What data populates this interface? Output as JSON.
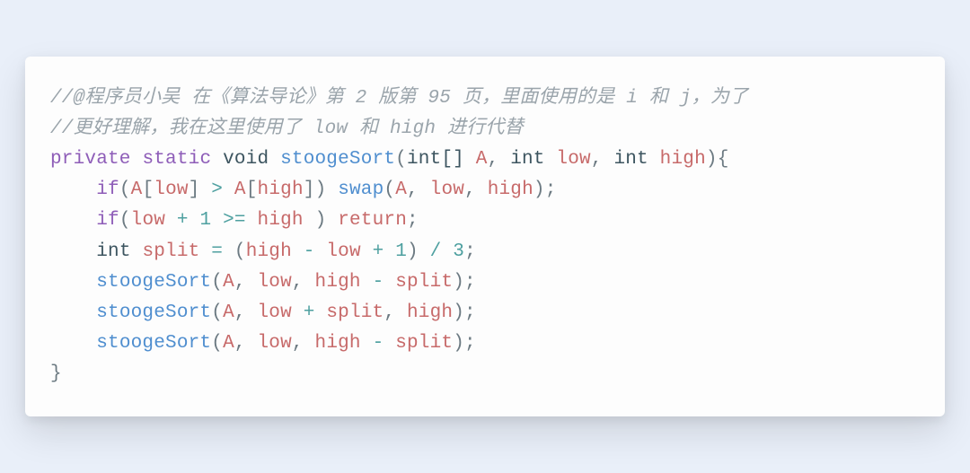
{
  "code": {
    "comment1": "//@程序员小吴 在《算法导论》第 2 版第 95 页，里面使用的是 i 和 j，为了",
    "comment2": "//更好理解，我在这里使用了 low 和 high 进行代替",
    "kw_private": "private",
    "kw_static": "static",
    "ty_void": "void",
    "fn_stoogeSort": "stoogeSort",
    "ty_intArr": "int[]",
    "id_A": "A",
    "ty_int": "int",
    "id_low": "low",
    "id_high": "high",
    "kw_if": "if",
    "fn_swap": "swap",
    "op_plus": "+",
    "num_1": "1",
    "op_ge": ">=",
    "kw_return": "return",
    "id_split": "split",
    "op_eq": "=",
    "op_minus": "-",
    "op_div": "/",
    "num_3": "3",
    "paren_open": "(",
    "paren_close": ")",
    "brace_open": "{",
    "brace_close": "}",
    "bracket_open": "[",
    "bracket_close": "]",
    "comma": ",",
    "semi": ";",
    "op_gt": ">"
  }
}
